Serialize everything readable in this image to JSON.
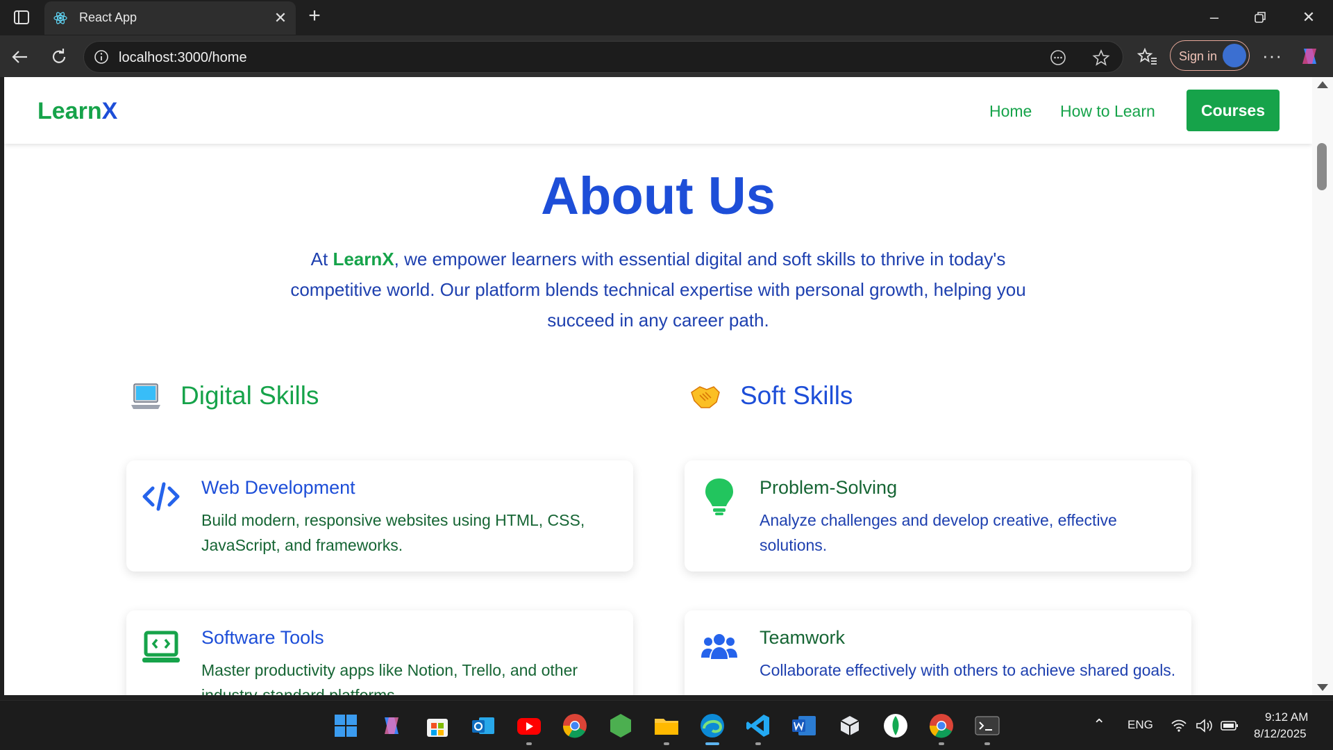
{
  "browser": {
    "tab_title": "React App",
    "url": "localhost:3000/home",
    "signin_label": "Sign in"
  },
  "navbar": {
    "logo_main": "Learn",
    "logo_accent": "X",
    "links": [
      "Home",
      "How to Learn"
    ],
    "cta": "Courses"
  },
  "about": {
    "title": "About Us",
    "text_prefix": "At ",
    "brand": "LearnX",
    "text_suffix": ", we empower learners with essential digital and soft skills to thrive in today's competitive world. Our platform blends technical expertise with personal growth, helping you succeed in any career path."
  },
  "sections": {
    "digital": {
      "label": "Digital Skills",
      "icon": "laptop-emoji",
      "color": "#16a34a"
    },
    "soft": {
      "label": "Soft Skills",
      "icon": "handshake-emoji",
      "color": "#1d4ed8"
    }
  },
  "cards": {
    "web_dev": {
      "title": "Web Development",
      "desc": "Build modern, responsive websites using HTML, CSS, JavaScript, and frameworks.",
      "icon": "code-icon"
    },
    "problem_solving": {
      "title": "Problem-Solving",
      "desc": "Analyze challenges and develop creative, effective solutions.",
      "icon": "lightbulb-icon"
    },
    "software_tools": {
      "title": "Software Tools",
      "desc": "Master productivity apps like Notion, Trello, and other industry-standard platforms.",
      "icon": "laptop-code-icon"
    },
    "teamwork": {
      "title": "Teamwork",
      "desc": "Collaborate effectively with others to achieve shared goals.",
      "icon": "users-icon"
    }
  },
  "taskbar": {
    "lang": "ENG",
    "time": "9:12 AM",
    "date": "8/12/2025"
  },
  "colors": {
    "green": "#16a34a",
    "blue": "#1d4ed8",
    "dark_blue": "#1e40af"
  }
}
